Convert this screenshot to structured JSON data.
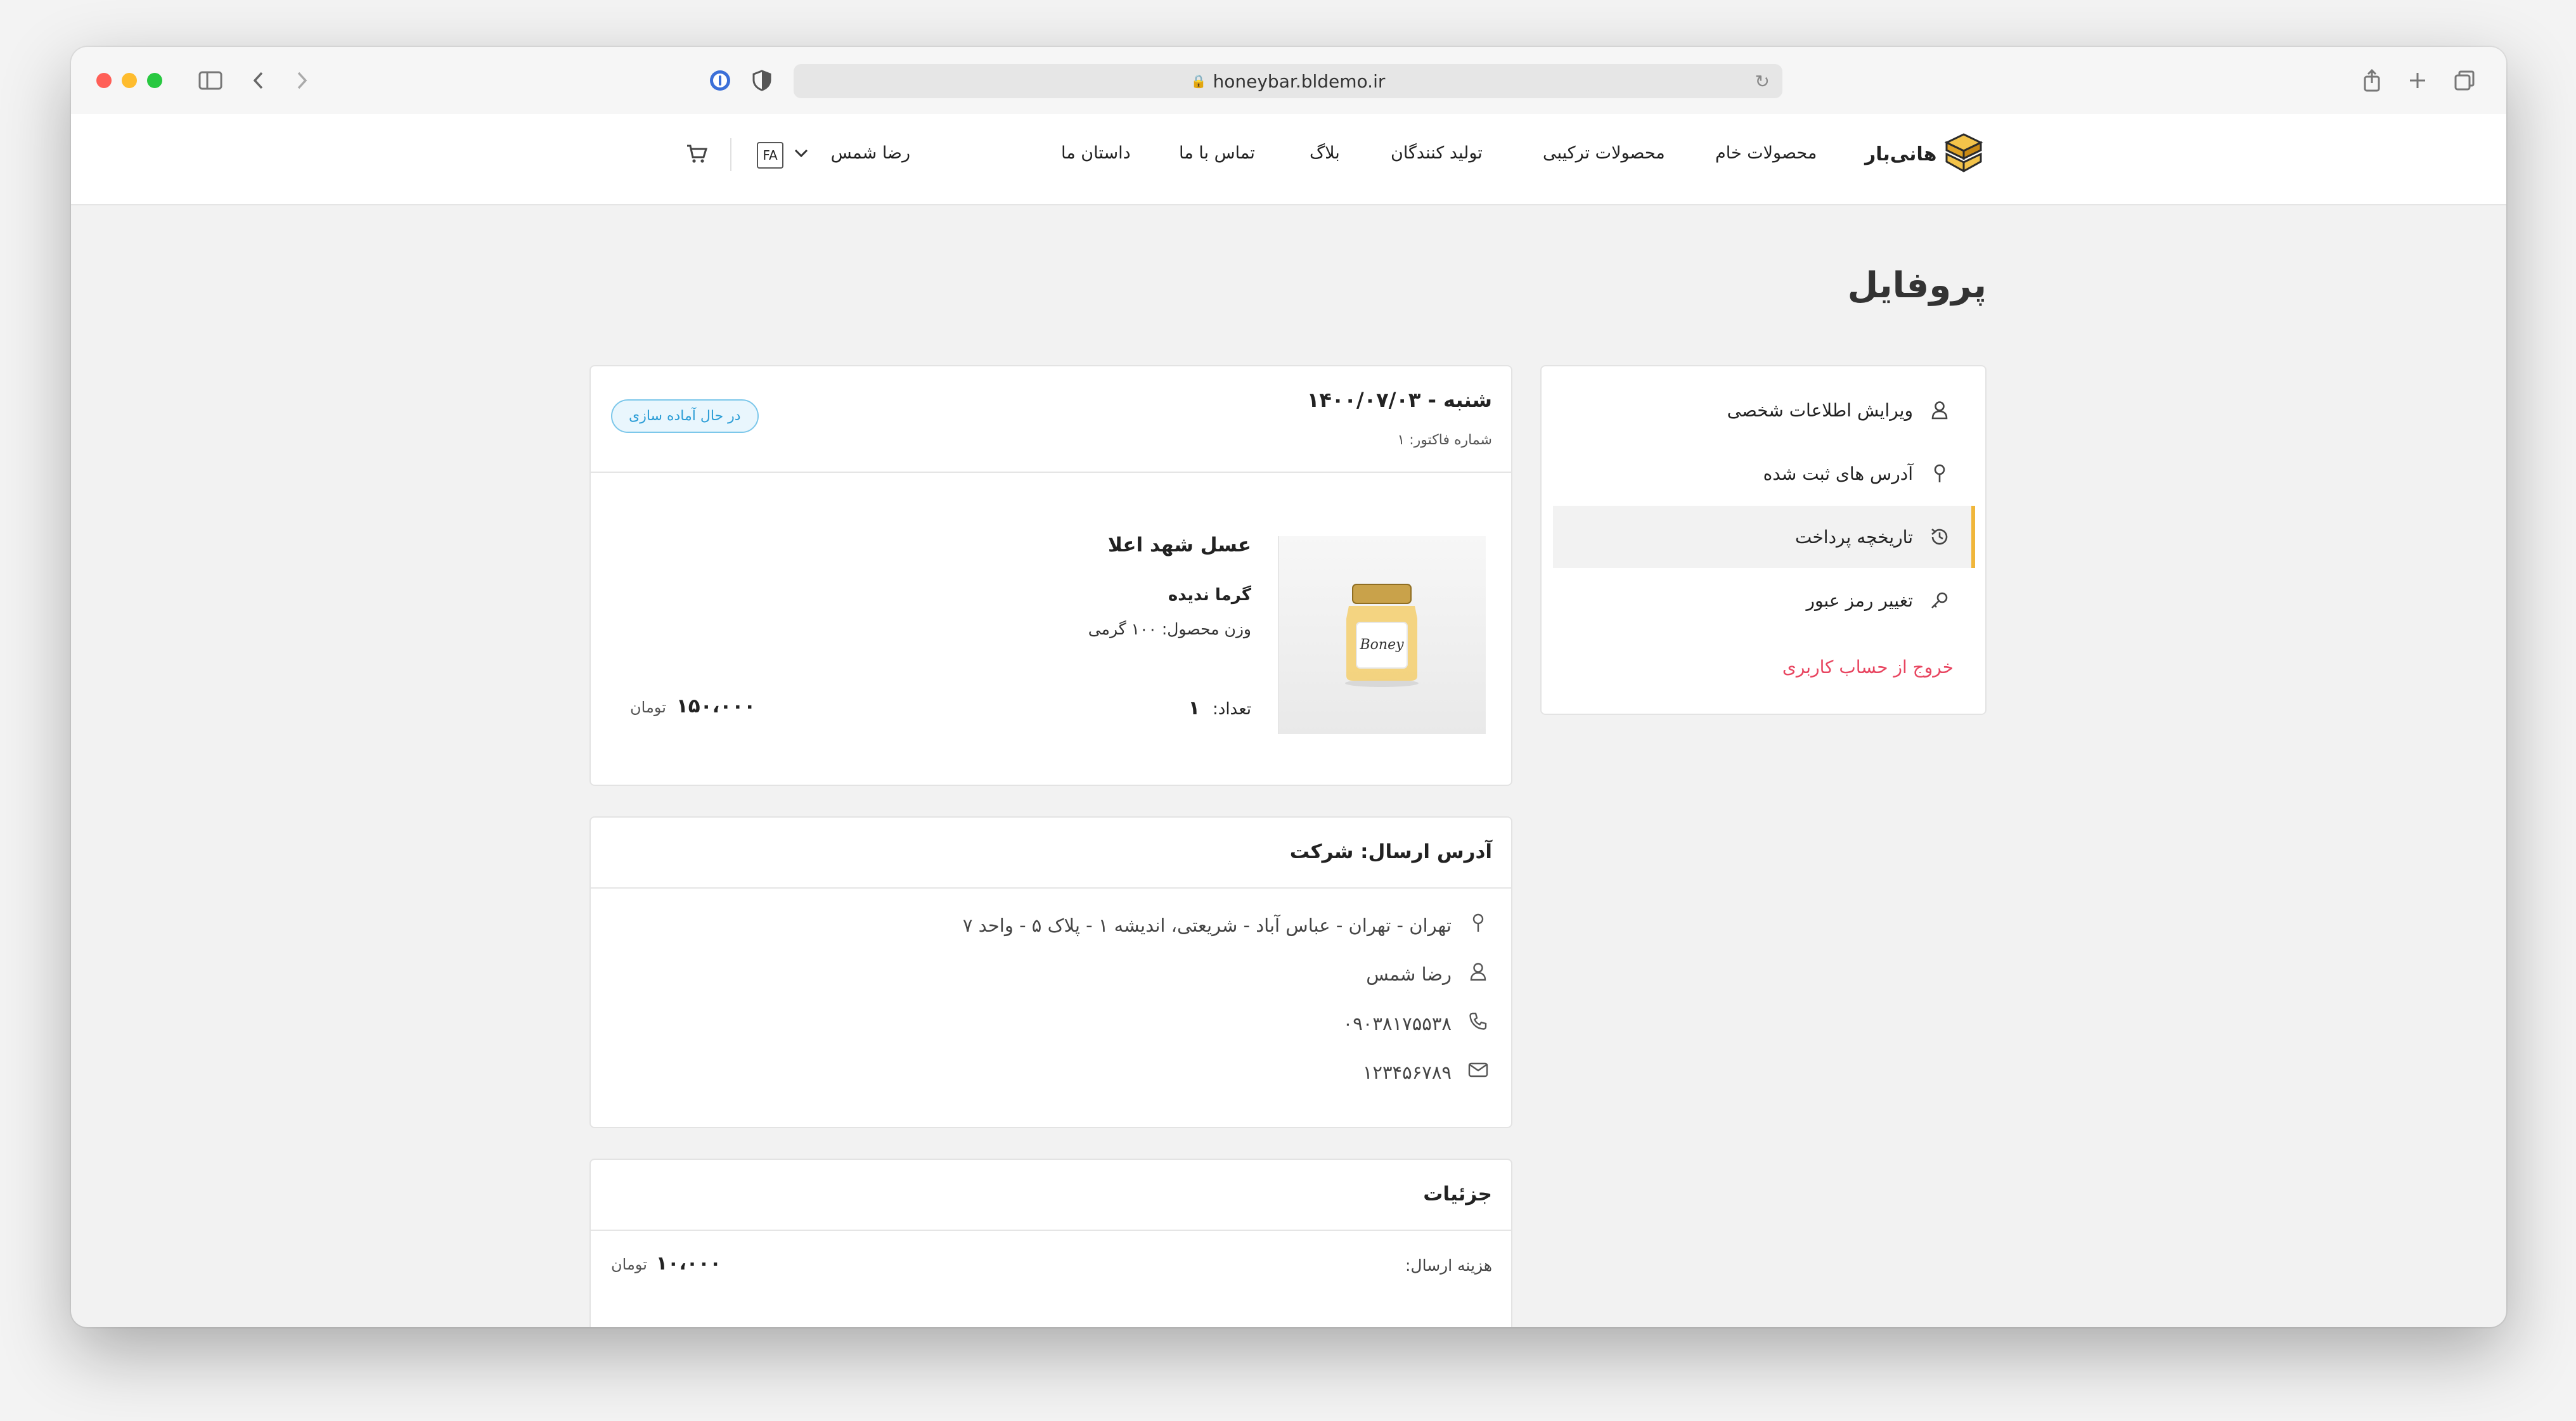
{
  "browser": {
    "url": "honeybar.bldemo.ir",
    "icons": {
      "sidebar": "sidebar-toggle-icon",
      "back": "chevron-left-icon",
      "forward": "chevron-right-icon",
      "password": "password-manager-icon",
      "shield": "shield-icon",
      "reload": "reload-icon",
      "share": "share-icon",
      "new_tab": "plus-icon",
      "tabs": "tabs-overview-icon"
    }
  },
  "nav": {
    "brand": "هانی‌بار",
    "items": [
      "محصولات خام",
      "محصولات ترکیبی",
      "تولید کنندگان",
      "بلاگ",
      "تماس با ما",
      "داستان ما"
    ],
    "user": "رضا شمس",
    "lang": "FA"
  },
  "page": {
    "title": "پروفایل"
  },
  "sidebar": {
    "items": [
      {
        "label": "ویرایش اطلاعات شخصی",
        "icon": "user-icon"
      },
      {
        "label": "آدرس های ثبت شده",
        "icon": "location-pin-icon"
      },
      {
        "label": "تاریخچه پرداخت",
        "icon": "history-icon"
      },
      {
        "label": "تغییر رمز عبور",
        "icon": "key-icon"
      }
    ],
    "active_index": 2,
    "logout": "خروج از حساب کاربری"
  },
  "order": {
    "date": "شنبه - ۱۴۰۰/۰۷/۰۳",
    "invoice": "شماره فاکتور: ۱",
    "status": "در حال آماده سازی",
    "product": {
      "name": "عسل شهد اعلا",
      "attribute": "گرما ندیده",
      "weight": "وزن محصول: ۱۰۰ گرمی",
      "qty_label": "تعداد:",
      "qty": "۱",
      "price": "۱۵۰،۰۰۰",
      "currency": "تومان"
    }
  },
  "address": {
    "title": "آدرس ارسال: شرکت",
    "line": "تهران - تهران - عباس آباد - شریعتی، اندیشه ۱ - پلاک ۵ - واحد ۷",
    "name": "رضا شمس",
    "phone": "۰۹۰۳۸۱۷۵۵۳۸",
    "postal": "۱۲۳۴۵۶۷۸۹"
  },
  "details": {
    "title": "جزئیات",
    "shipping_label": "هزینه ارسال:",
    "shipping_price": "۱۰،۰۰۰",
    "currency": "تومان"
  },
  "colors": {
    "accent": "#f0b63a",
    "logout": "#e84560",
    "status": "#2b9dd6"
  }
}
